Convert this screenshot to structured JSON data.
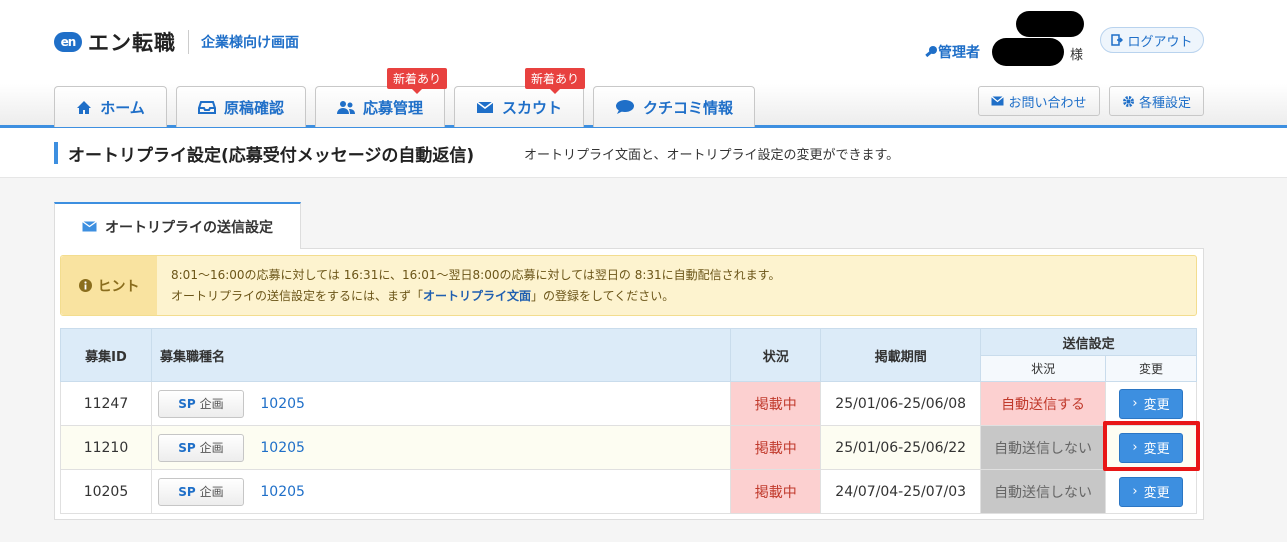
{
  "header": {
    "logo_mark": "en",
    "logo_text": "エン転職",
    "logo_sub": "企業様向け画面",
    "admin_label": "管理者",
    "honorific": "様",
    "logout_label": "ログアウト"
  },
  "nav": {
    "tabs": [
      {
        "label": "ホーム",
        "icon": "home-icon"
      },
      {
        "label": "原稿確認",
        "icon": "inbox-icon"
      },
      {
        "label": "応募管理",
        "icon": "people-icon",
        "badge": "新着あり"
      },
      {
        "label": "スカウト",
        "icon": "mail-icon",
        "badge": "新着あり"
      },
      {
        "label": "クチコミ情報",
        "icon": "chat-icon"
      }
    ],
    "contact_label": "お問い合わせ",
    "settings_label": "各種設定"
  },
  "page": {
    "title": "オートリプライ設定(応募受付メッセージの自動返信)",
    "description": "オートリプライ文面と、オートリプライ設定の変更ができます。",
    "tab_label": "オートリプライの送信設定"
  },
  "hint": {
    "label": "ヒント",
    "line1": "8:01～16:00の応募に対しては 16:31に、16:01～翌日8:00の応募に対しては翌日の 8:31に自動配信されます。",
    "line2_pre": "オートリプライの送信設定をするには、まず「",
    "line2_link": "オートリプライ文面",
    "line2_post": "」の登録をしてください。"
  },
  "table": {
    "headers": {
      "id": "募集ID",
      "job": "募集職種名",
      "status": "状況",
      "period": "掲載期間",
      "send": "送信設定",
      "send_status": "状況",
      "send_change": "変更"
    },
    "rows": [
      {
        "id": "11247",
        "sp": "SP",
        "plan": "企画",
        "job": "10205",
        "status": "掲載中",
        "period": "25/01/06-25/06/08",
        "send_status": "自動送信する",
        "change": "変更"
      },
      {
        "id": "11210",
        "sp": "SP",
        "plan": "企画",
        "job": "10205",
        "status": "掲載中",
        "period": "25/01/06-25/06/22",
        "send_status": "自動送信しない",
        "change": "変更"
      },
      {
        "id": "10205",
        "sp": "SP",
        "plan": "企画",
        "job": "10205",
        "status": "掲載中",
        "period": "24/07/04-25/07/03",
        "send_status": "自動送信しない",
        "change": "変更"
      }
    ]
  }
}
